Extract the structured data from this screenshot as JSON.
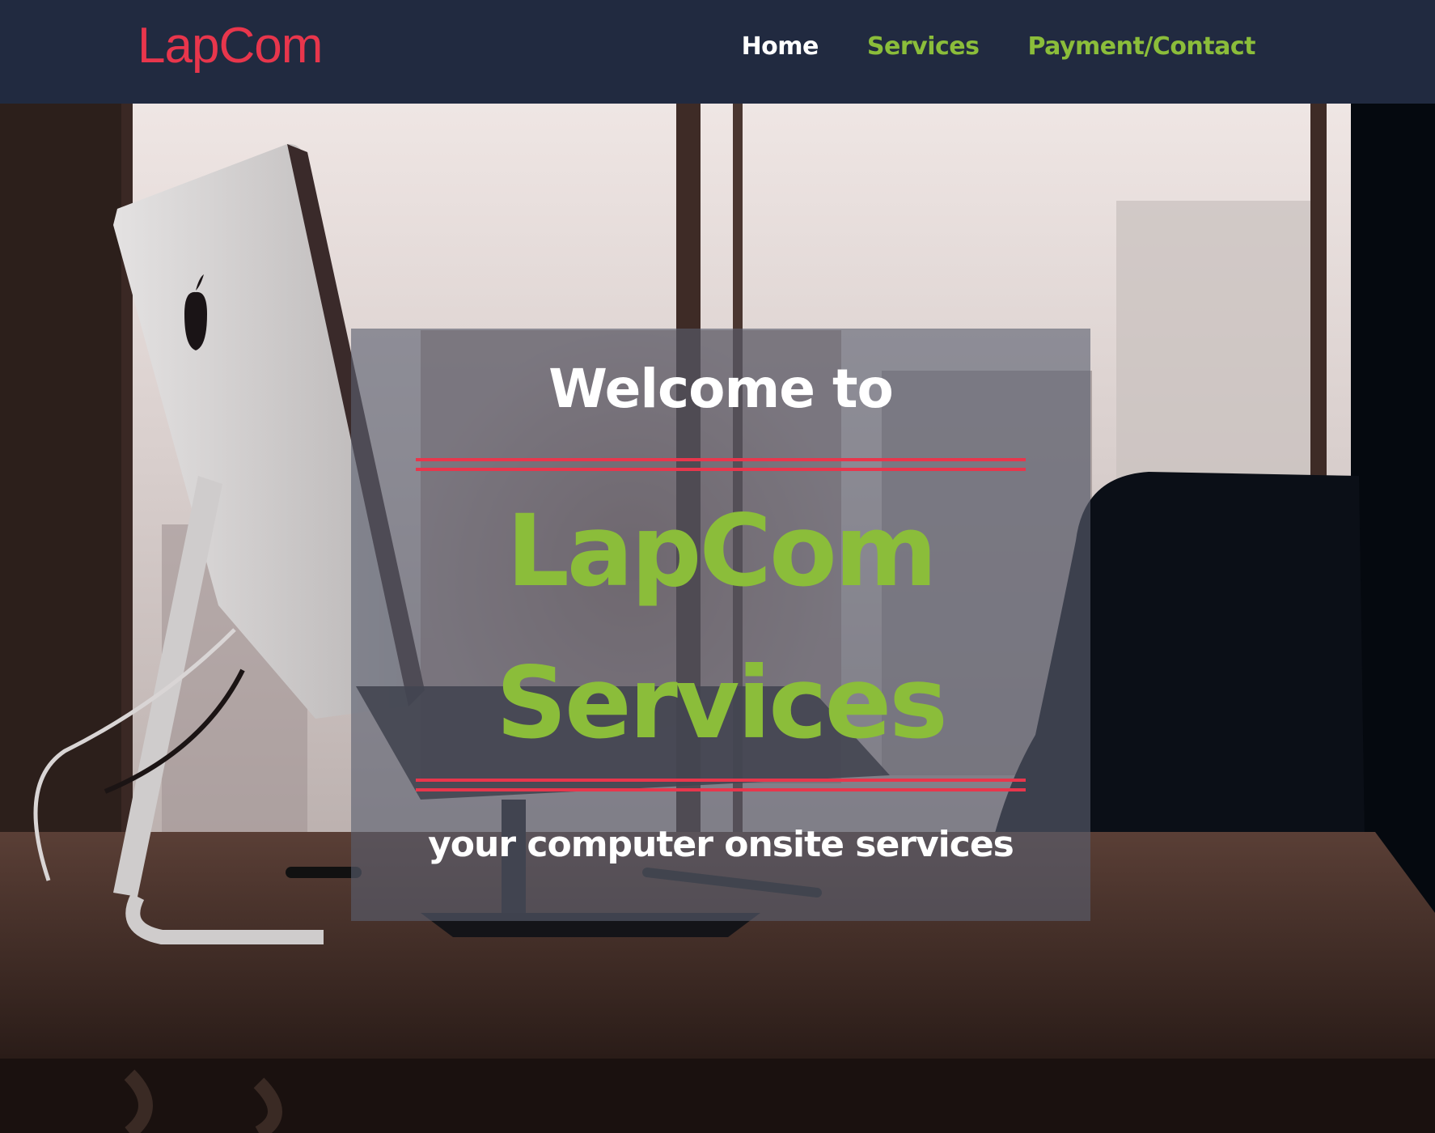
{
  "navbar": {
    "brand": "LapCom",
    "links": [
      {
        "label": "Home",
        "active": true
      },
      {
        "label": "Services",
        "active": false
      },
      {
        "label": "Payment/Contact",
        "active": false
      }
    ]
  },
  "hero": {
    "welcome": "Welcome to",
    "title_line1": "LapCom",
    "title_line2": "Services",
    "tagline": "your computer onsite services"
  },
  "colors": {
    "nav_background": "#212a40",
    "brand_red": "#e8364c",
    "accent_green": "#8bbd3a",
    "text_white": "#ffffff"
  },
  "icons": [
    "apple-logo-icon"
  ]
}
